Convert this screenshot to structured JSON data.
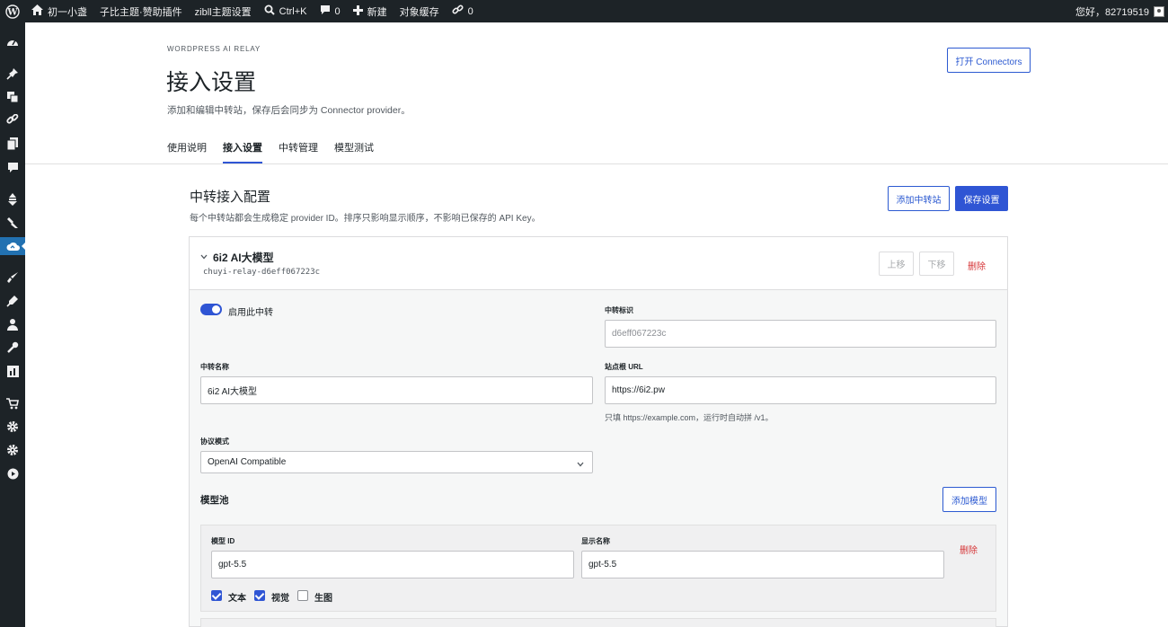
{
  "adminbar": {
    "site_name": "初一小盏",
    "plugin_link": "子比主题·赞助插件",
    "theme_settings": "zibll主题设置",
    "search_shortcut": "Ctrl+K",
    "comments_count": "0",
    "new_label": "新建",
    "cache_label": "对象缓存",
    "links_count": "0",
    "greeting": "您好，82719519"
  },
  "header": {
    "eyebrow": "WORDPRESS AI RELAY",
    "title": "接入设置",
    "description": "添加和编辑中转站，保存后会同步为 Connector provider。",
    "open_connectors": "打开 Connectors"
  },
  "tabs": [
    {
      "label": "使用说明",
      "active": false
    },
    {
      "label": "接入设置",
      "active": true
    },
    {
      "label": "中转管理",
      "active": false
    },
    {
      "label": "模型测试",
      "active": false
    }
  ],
  "section": {
    "title": "中转接入配置",
    "description": "每个中转站都会生成稳定 provider ID。排序只影响显示顺序，不影响已保存的 API Key。",
    "add_relay": "添加中转站",
    "save_settings": "保存设置"
  },
  "relay": {
    "name": "6i2 AI大模型",
    "slug": "chuyi-relay-d6eff067223c",
    "move_up": "上移",
    "move_down": "下移",
    "delete": "删除",
    "enable_label": "启用此中转",
    "enabled": true,
    "id_label": "中转标识",
    "id_value": "d6eff067223c",
    "name_label": "中转名称",
    "name_value": "6i2 AI大模型",
    "url_label": "站点根 URL",
    "url_value": "https://6i2.pw",
    "url_hint": "只填 https://example.com，运行时自动拼 /v1。",
    "protocol_label": "协议模式",
    "protocol_value": "OpenAI Compatible",
    "model_pool_title": "模型池",
    "add_model": "添加模型",
    "models": [
      {
        "id_label": "模型 ID",
        "id_value": "gpt-5.5",
        "display_label": "显示名称",
        "display_value": "gpt-5.5",
        "delete": "删除",
        "caps": [
          {
            "label": "文本",
            "checked": true
          },
          {
            "label": "视觉",
            "checked": true
          },
          {
            "label": "生图",
            "checked": false
          }
        ]
      }
    ]
  },
  "icons": {
    "wp": "wordpress-logo-icon",
    "home": "home-icon",
    "search": "search-icon",
    "comment": "comment-icon",
    "plus": "plus-icon",
    "link": "link-icon",
    "chevron": "chevron-down-icon"
  },
  "colors": {
    "accent": "#2f55d4",
    "danger": "#d63638",
    "adminbar": "#1d2327"
  }
}
